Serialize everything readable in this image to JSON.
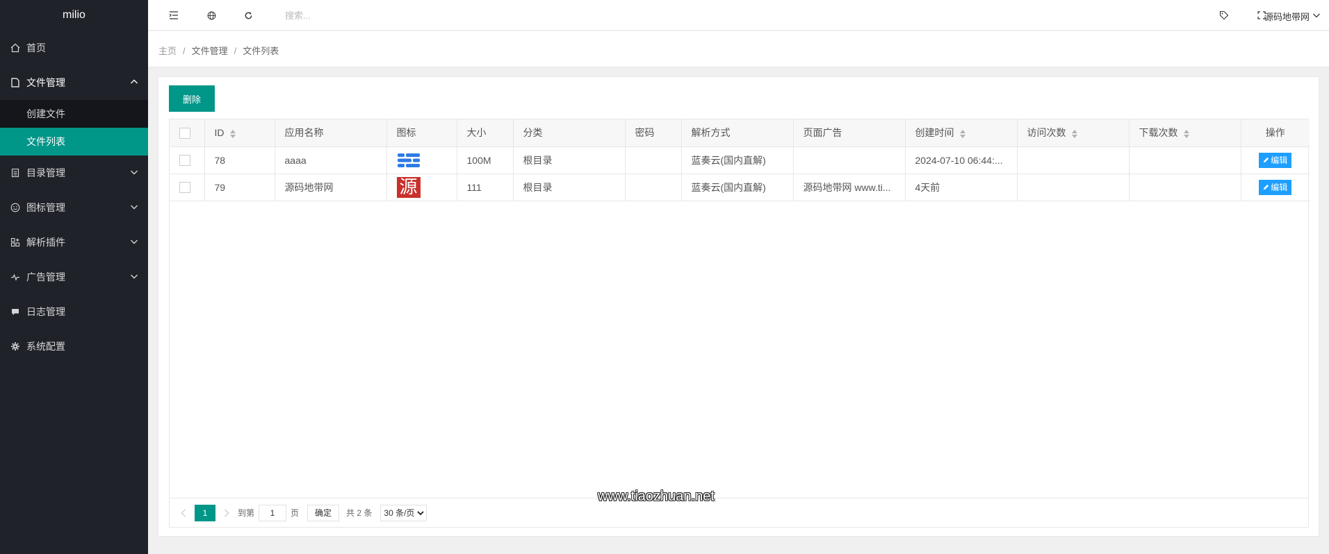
{
  "app": {
    "logo": "milio"
  },
  "sidebar": {
    "items": [
      {
        "label": "首页",
        "icon": "home-icon"
      },
      {
        "label": "文件管理",
        "icon": "file-icon",
        "open": true,
        "children": [
          {
            "label": "创建文件"
          },
          {
            "label": "文件列表",
            "active": true
          }
        ]
      },
      {
        "label": "目录管理",
        "icon": "folder-list-icon"
      },
      {
        "label": "图标管理",
        "icon": "smile-icon"
      },
      {
        "label": "解析插件",
        "icon": "app-icon"
      },
      {
        "label": "广告管理",
        "icon": "pulse-icon"
      },
      {
        "label": "日志管理",
        "icon": "chat-icon"
      },
      {
        "label": "系统配置",
        "icon": "gear-icon"
      }
    ]
  },
  "topbar": {
    "search_placeholder": "搜索...",
    "user_name": "源码地带网"
  },
  "breadcrumb": {
    "items": [
      "主页",
      "文件管理",
      "文件列表"
    ]
  },
  "toolbar": {
    "delete_label": "删除"
  },
  "table": {
    "headers": {
      "id": "ID",
      "name": "应用名称",
      "icon": "图标",
      "size": "大小",
      "category": "分类",
      "password": "密码",
      "parse": "解析方式",
      "ad": "页面广告",
      "created": "创建时间",
      "visits": "访问次数",
      "downloads": "下载次数",
      "actions": "操作"
    },
    "rows": [
      {
        "id": "78",
        "name": "aaaa",
        "icon": "lanzou-icon",
        "size": "100M",
        "category": "根目录",
        "password": "",
        "parse": "蓝奏云(国内直解)",
        "ad": "",
        "created": "2024-07-10 06:44:...",
        "visits": "",
        "downloads": "",
        "action": "编辑"
      },
      {
        "id": "79",
        "name": "源码地带网",
        "icon": "源",
        "size": "111",
        "category": "根目录",
        "password": "",
        "parse": "蓝奏云(国内直解)",
        "ad": "源码地带网 www.ti...",
        "created": "4天前",
        "visits": "",
        "downloads": "",
        "action": "编辑"
      }
    ]
  },
  "pager": {
    "current": "1",
    "goto_label": "到第",
    "goto_value": "1",
    "page_label": "页",
    "confirm": "确定",
    "total": "共 2 条",
    "per_page": "30 条/页"
  },
  "watermark": "www.tiaozhuan.net",
  "colors": {
    "sidebar_bg": "#20222a",
    "accent": "#009688",
    "edit_blue": "#1e9fff"
  }
}
